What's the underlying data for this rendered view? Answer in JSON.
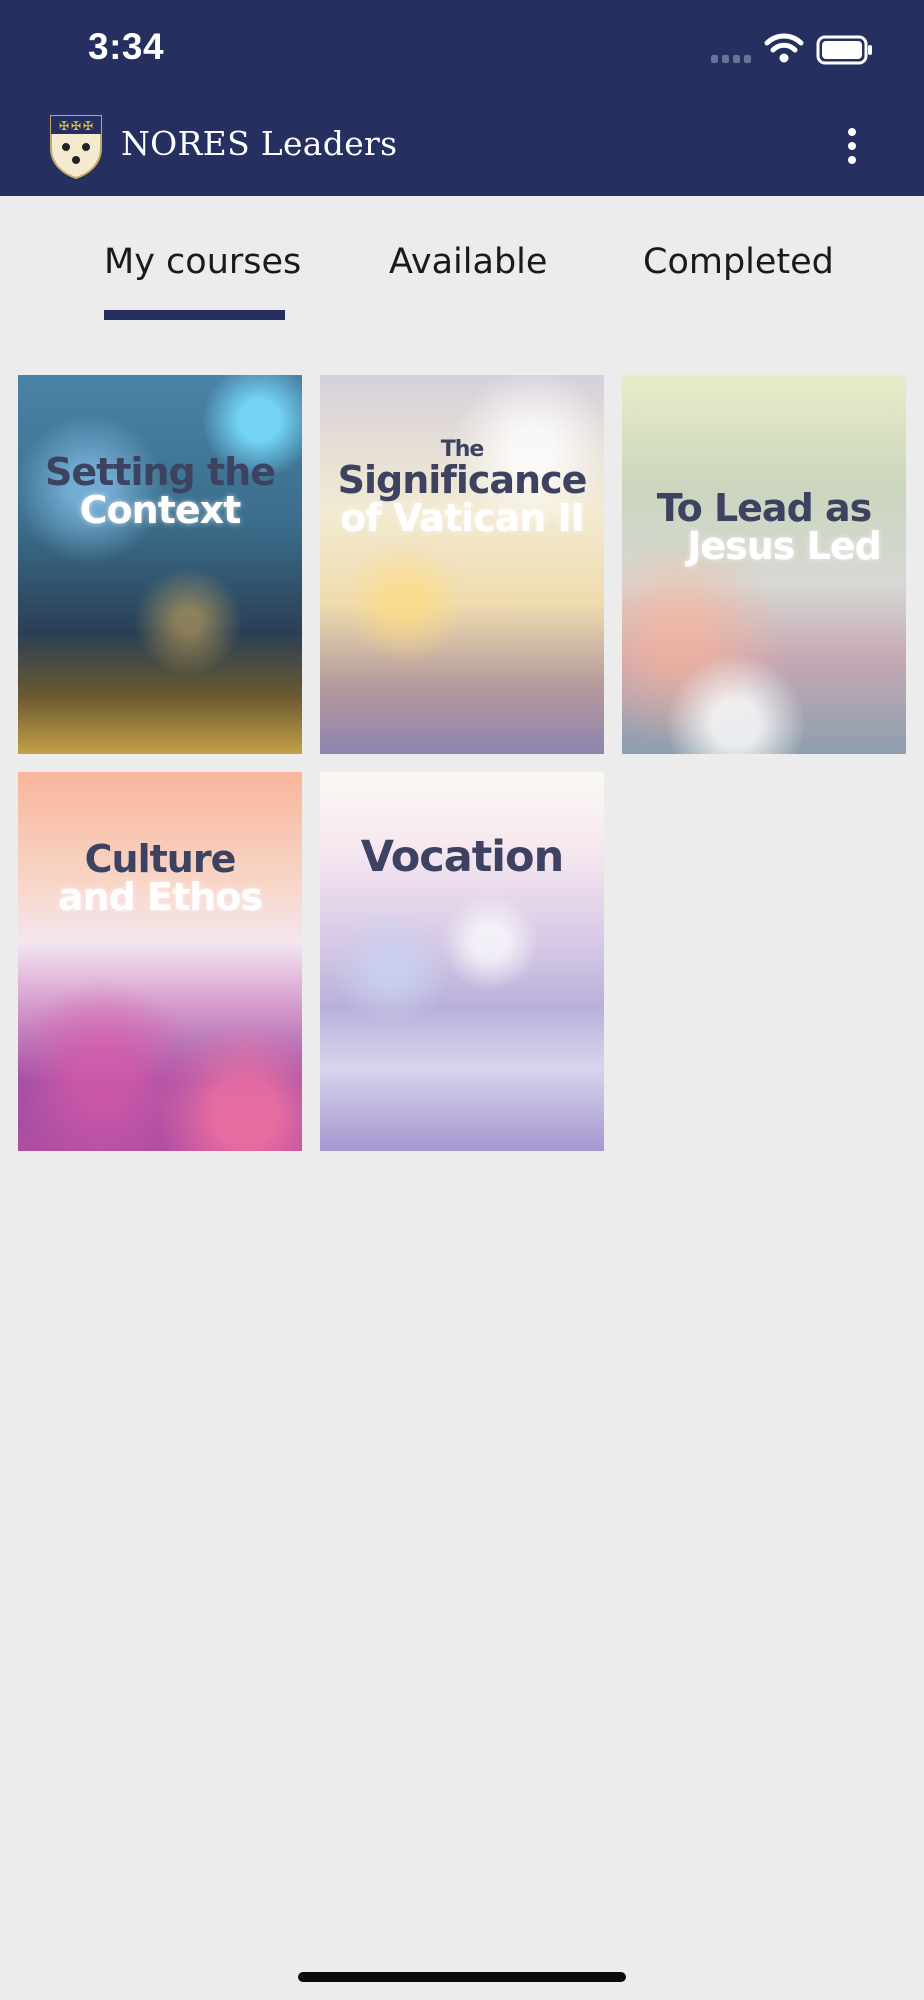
{
  "status_bar": {
    "time": "3:34",
    "icons": [
      "cellular-signal-icon",
      "wifi-icon",
      "battery-icon"
    ]
  },
  "header": {
    "app_title": "NORES Leaders",
    "logo": "crest-logo",
    "menu_icon": "more-vertical-icon"
  },
  "tabs": [
    {
      "label": "My courses",
      "selected": true
    },
    {
      "label": "Available",
      "selected": false
    },
    {
      "label": "Completed",
      "selected": false
    }
  ],
  "courses": [
    {
      "title_line1": "Setting the",
      "title_line2": "Context"
    },
    {
      "title_line0": "The",
      "title_line1": "Significance",
      "title_line2": "of Vatican II"
    },
    {
      "title_line1": "To Lead as",
      "title_line2": "Jesus Led"
    },
    {
      "title_line1": "Culture",
      "title_line2": "and Ethos"
    },
    {
      "title_line1": "Vocation"
    }
  ],
  "colors": {
    "header_background": "#263060",
    "tab_indicator": "#263060",
    "page_background": "#ececec",
    "cover_title_text": "#3c4260"
  }
}
